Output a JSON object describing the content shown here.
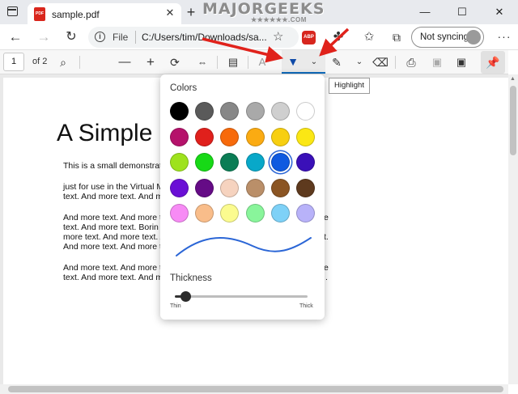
{
  "browser": {
    "tab_title": "sample.pdf",
    "pdf_icon_text": "PDF",
    "tab_close": "✕",
    "new_tab": "+",
    "window_minimize": "—",
    "window_maximize": "☐",
    "window_close": "✕",
    "watermark": "MAJORGEEKS",
    "watermark_sub": "★★★★★★.COM"
  },
  "address_bar": {
    "scheme_label": "File",
    "url": "C:/Users/tim/Downloads/sa...",
    "abp_label": "ABP",
    "sync_label": "Not syncing"
  },
  "pdf_toolbar": {
    "page_number": "1",
    "page_count": "of 2",
    "zoom_out": "—",
    "zoom_in": "+"
  },
  "document": {
    "title": "A Simple P",
    "lines": [
      "This is a small demonstrat",
      "just for use in the Virtual M",
      "text. And more text. And m",
      "And more text. And more t",
      "text. And more text. Borin",
      "more text. And more text. A",
      "And more text. And more t",
      "And more text. And more t",
      "text. And more text. And m"
    ],
    "right_fragments": [
      "e",
      "t.",
      "e",
      "."
    ]
  },
  "highlight_panel": {
    "colors_title": "Colors",
    "thickness_title": "Thickness",
    "thin_label": "Thin",
    "thick_label": "Thick",
    "thickness_value": 0.05,
    "selected_color": "#0f5ae0",
    "stroke_color": "#2b66d6",
    "swatches": [
      [
        "#000000",
        "#5a5a5a",
        "#878787",
        "#a9a9a9",
        "#cfcfcf",
        "#ffffff"
      ],
      [
        "#b5126b",
        "#e0201c",
        "#f76a0b",
        "#fbab12",
        "#f7cf10",
        "#fbe714"
      ],
      [
        "#9ee21d",
        "#17d916",
        "#0b7d55",
        "#08a8c9",
        "#0f5ae0",
        "#3a10b8"
      ],
      [
        "#6a0fd6",
        "#650b86",
        "#f6d3bf",
        "#ba8f69",
        "#8b5523",
        "#5e3a1e"
      ],
      [
        "#f78bf5",
        "#f9bd8a",
        "#fbfb8f",
        "#89f59b",
        "#7ed1f7",
        "#b8b2f9"
      ]
    ]
  },
  "tooltip": {
    "text": "Highlight"
  },
  "colors": {
    "accent": "#0f6cbd",
    "arrow": "#e0221b"
  }
}
